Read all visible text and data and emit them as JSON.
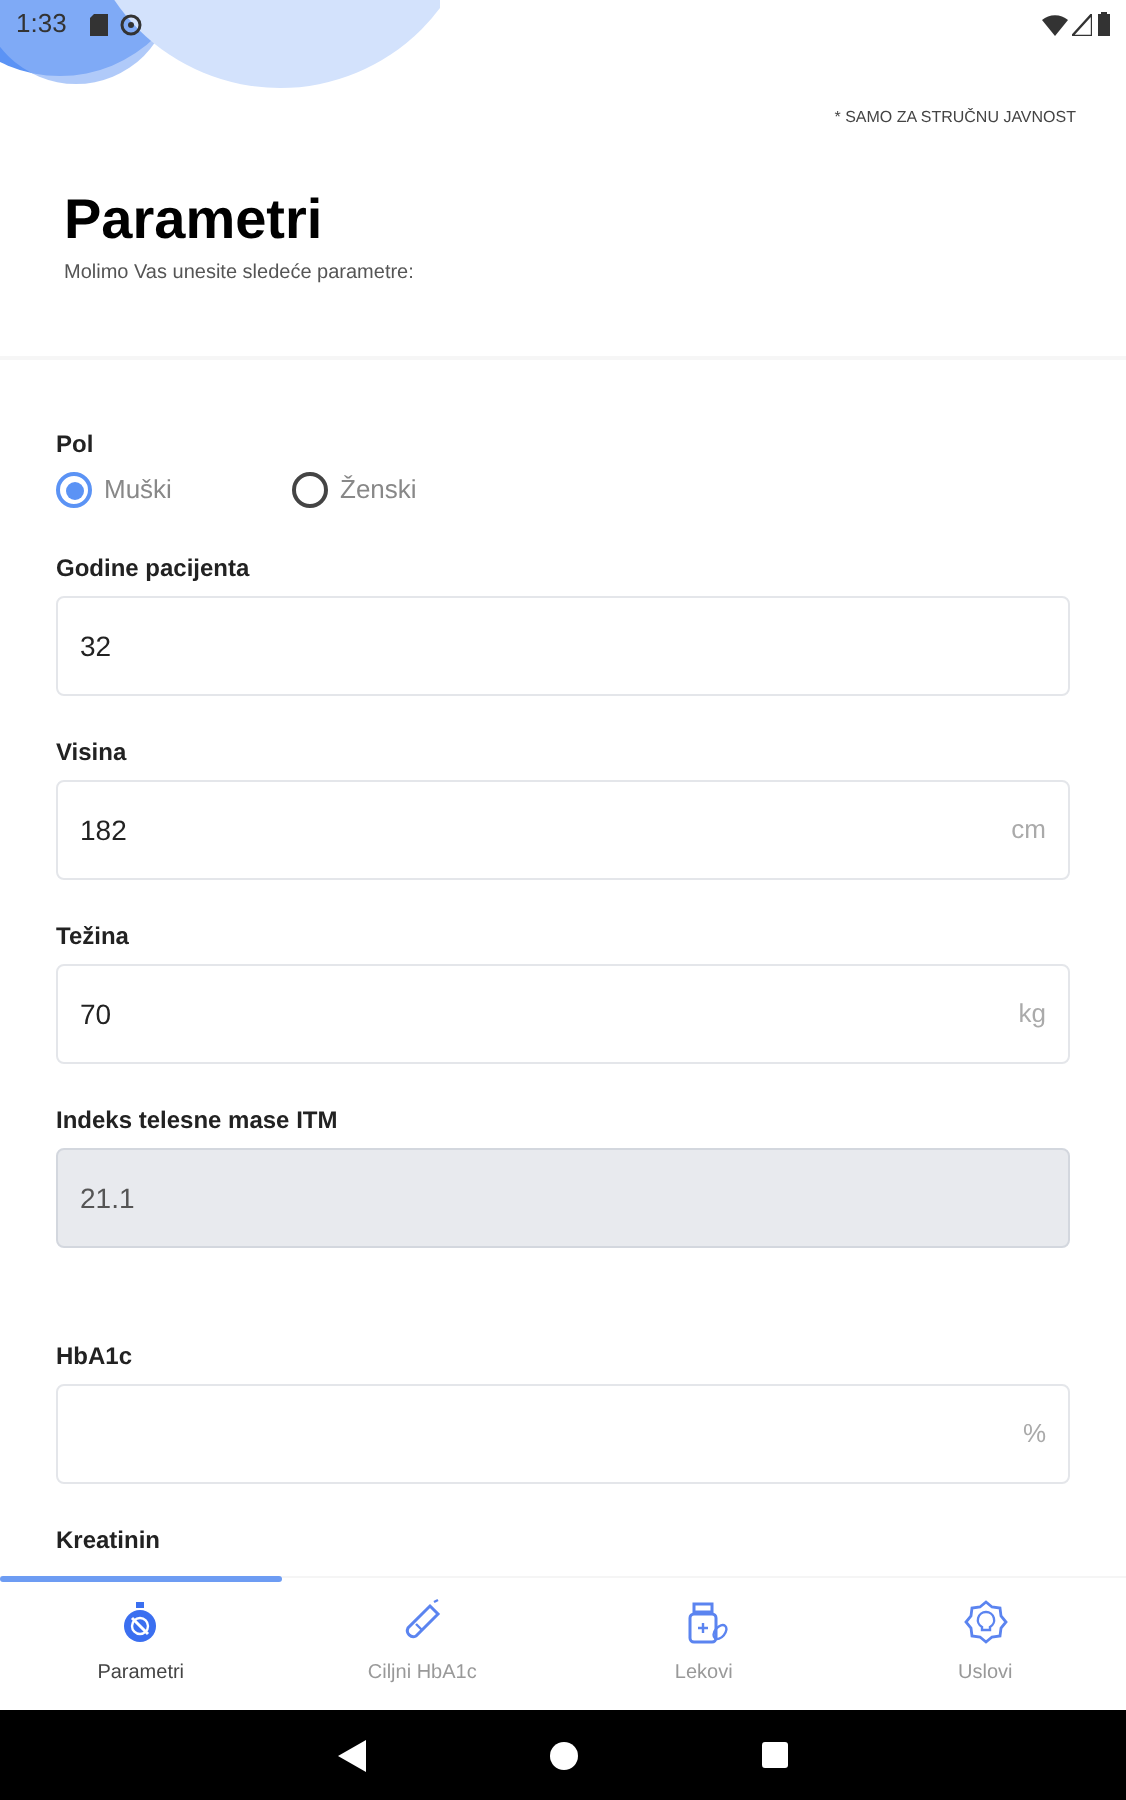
{
  "status_bar": {
    "time": "1:33"
  },
  "header": {
    "notice": "* SAMO ZA STRUČNU JAVNOST",
    "title": "Parametri",
    "subtitle": "Molimo Vas unesite sledeće parametre:"
  },
  "fields": [
    {
      "kind": "radio",
      "label": "Pol",
      "options": [
        {
          "label": "Muški",
          "selected": true
        },
        {
          "label": "Ženski",
          "selected": false
        }
      ]
    },
    {
      "kind": "input",
      "label": "Godine pacijenta",
      "value": "32",
      "disabled": false
    },
    {
      "kind": "input",
      "label": "Visina",
      "value": "182",
      "unit": "cm",
      "disabled": false
    },
    {
      "kind": "input",
      "label": "Težina",
      "value": "70",
      "unit": "kg",
      "disabled": false
    },
    {
      "kind": "input",
      "label": "Indeks telesne mase ITM",
      "value": "21.1",
      "disabled": true
    },
    {
      "kind": "spacer"
    },
    {
      "kind": "input",
      "label": "HbA1c",
      "unit": "%",
      "disabled": false
    },
    {
      "kind": "label",
      "label": "Kreatinin"
    }
  ],
  "tabs": [
    {
      "label": "Parametri",
      "selected": true
    },
    {
      "label": "Ciljni HbA1c",
      "selected": false
    },
    {
      "label": "Lekovi",
      "selected": false
    },
    {
      "label": "Uslovi",
      "selected": false
    }
  ]
}
